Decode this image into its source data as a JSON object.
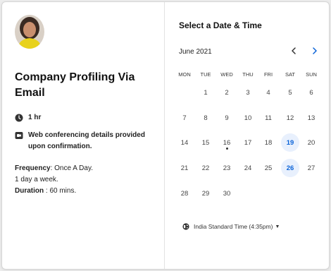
{
  "event": {
    "title": "Company Profiling Via Email",
    "duration": "1 hr",
    "conference_info": "Web conferencing details provided upon confirmation.",
    "frequency_label": "Frequency",
    "frequency_value": ": Once A Day.",
    "frequency_note": "1 day a week.",
    "duration_label": "Duration",
    "duration_value": " : 60 mins."
  },
  "calendar": {
    "heading": "Select a Date & Time",
    "month": "June 2021",
    "weekdays": [
      "MON",
      "TUE",
      "WED",
      "THU",
      "FRI",
      "SAT",
      "SUN"
    ],
    "weeks": [
      [
        "",
        "1",
        "2",
        "3",
        "4",
        "5",
        "6"
      ],
      [
        "7",
        "8",
        "9",
        "10",
        "11",
        "12",
        "13"
      ],
      [
        "14",
        "15",
        "16",
        "17",
        "18",
        "19",
        "20"
      ],
      [
        "21",
        "22",
        "23",
        "24",
        "25",
        "26",
        "27"
      ],
      [
        "28",
        "29",
        "30",
        "",
        "",
        "",
        ""
      ]
    ],
    "available_days": [
      "19",
      "26"
    ],
    "today": "16",
    "accent_color": "#0a63d8",
    "available_bg": "#e8f0fd"
  },
  "timezone": {
    "label": "India Standard Time (4:35pm)"
  },
  "icons": {
    "duration": "clock-icon",
    "conference": "video-camera-icon",
    "timezone": "globe-icon",
    "prev": "chevron-left-icon",
    "next": "chevron-right-icon"
  }
}
